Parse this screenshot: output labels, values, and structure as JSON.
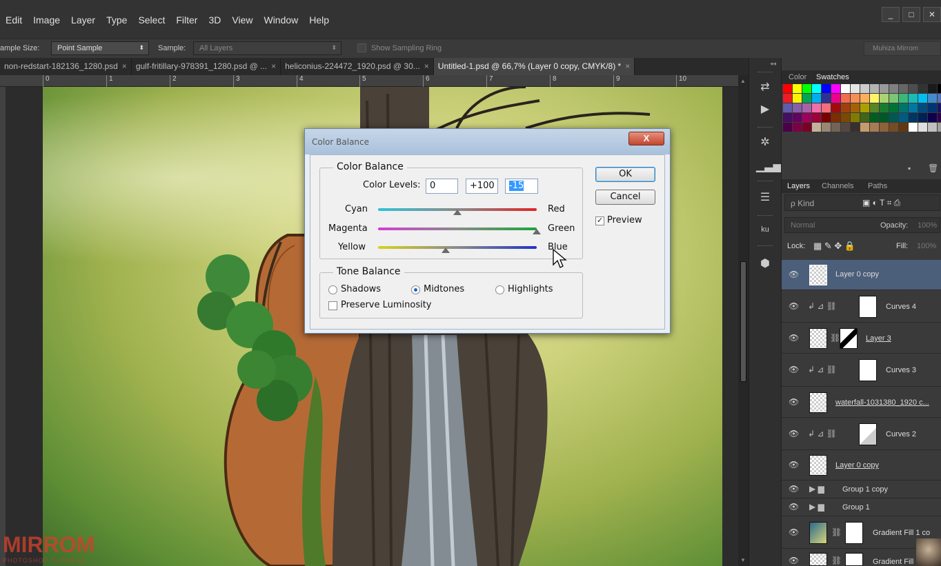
{
  "menu": [
    "Edit",
    "Image",
    "Layer",
    "Type",
    "Select",
    "Filter",
    "3D",
    "View",
    "Window",
    "Help"
  ],
  "window_buttons": [
    "_",
    "□",
    "✕"
  ],
  "options": {
    "sample_size_label": "ample Size:",
    "sample_size_value": "Point Sample",
    "sample_label": "Sample:",
    "sample_value": "All Layers",
    "show_ring_label": "Show Sampling Ring",
    "user": "Muhiza Mirrom"
  },
  "tabs": [
    {
      "label": "non-redstart-182136_1280.psd",
      "close": "×"
    },
    {
      "label": "gulf-fritillary-978391_1280.psd @ ...",
      "close": "×"
    },
    {
      "label": "heliconius-224472_1920.psd @ 30...",
      "close": "×"
    },
    {
      "label": "Untitled-1.psd @ 66,7% (Layer 0 copy, CMYK/8) *",
      "close": "×"
    }
  ],
  "ruler": [
    "0",
    "1",
    "2",
    "3",
    "4",
    "5",
    "6",
    "7",
    "8",
    "9",
    "10"
  ],
  "watermark": {
    "logo": "MIRROM",
    "sub": "PHOTOSHOP TUTORIAL"
  },
  "dialog": {
    "title": "Color Balance",
    "close": "X",
    "color_balance_legend": "Color Balance",
    "color_levels_label": "Color Levels:",
    "levels": [
      "0",
      "+100",
      "-15"
    ],
    "rows": [
      {
        "left": "Cyan",
        "right": "Red",
        "value": 0
      },
      {
        "left": "Magenta",
        "right": "Green",
        "value": 100
      },
      {
        "left": "Yellow",
        "right": "Blue",
        "value": -15
      }
    ],
    "tone_legend": "Tone Balance",
    "shadows": "Shadows",
    "midtones": "Midtones",
    "highlights": "Highlights",
    "selected_tone": "Midtones",
    "preserve": "Preserve Luminosity",
    "preserve_checked": false,
    "ok": "OK",
    "cancel": "Cancel",
    "preview": "Preview",
    "preview_checked": true
  },
  "panel_tabs_top": {
    "color": "Color",
    "swatches": "Swatches"
  },
  "panel_tabs_layers": {
    "layers": "Layers",
    "channels": "Channels",
    "paths": "Paths"
  },
  "layers_filter": {
    "kind": "ρ Kind",
    "icons": "▣ ◐ T ⌗ ⎙"
  },
  "blend": {
    "mode": "Normal",
    "opacity_label": "Opacity:",
    "opacity": "100%",
    "lock_label": "Lock:",
    "fill_label": "Fill:",
    "fill": "100%"
  },
  "layers": [
    {
      "name": "Layer 0 copy",
      "selected": true
    },
    {
      "name": "Curves 4",
      "selected": false
    },
    {
      "name": "Layer 3",
      "selected": false
    },
    {
      "name": "Curves 3",
      "selected": false
    },
    {
      "name": "waterfall-1031380_1920 c...",
      "selected": false
    },
    {
      "name": "Curves 2",
      "selected": false
    },
    {
      "name": "Layer 0 copy",
      "selected": false
    },
    {
      "name": "Group 1 copy",
      "selected": false
    },
    {
      "name": "Group 1",
      "selected": false
    },
    {
      "name": "Gradient Fill 1 co",
      "selected": false
    },
    {
      "name": "Gradient Fill",
      "selected": false
    }
  ],
  "colors": {
    "selection": "#4b5e7a",
    "dialog_ok_border": "#3c7fb1"
  }
}
